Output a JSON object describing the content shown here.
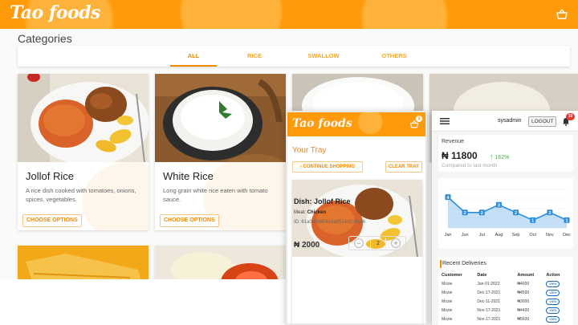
{
  "site": {
    "logo": "Tao foods",
    "categories_title": "Categories",
    "tabs": [
      {
        "label": "ALL",
        "active": true
      },
      {
        "label": "RICE",
        "active": false
      },
      {
        "label": "SWALLOW",
        "active": false
      },
      {
        "label": "OTHERS",
        "active": false
      }
    ],
    "cards": [
      {
        "title": "Jollof Rice",
        "description": "A rice dish cooked with tomatoes, onions, spices, vegetables.",
        "button": "CHOOSE OPTIONS"
      },
      {
        "title": "White Rice",
        "description": "Long grain white rice eaten with tomato sauce.",
        "button": "CHOOSE OPTIONS"
      }
    ]
  },
  "phone": {
    "logo": "Tao foods",
    "cart_count": "1",
    "tray_title": "Your Tray",
    "continue_label": "CONTINUE SHOPPING",
    "clear_label": "CLEAR TRAY",
    "dish_label": "Dish: Jollof Rice",
    "meat_label": "Meat:",
    "meat_value": "Chicken",
    "order_id": "ID: 61a0b5b804e3a9514c010e66",
    "price": "₦ 2000",
    "quantity": "2"
  },
  "admin": {
    "username": "sysadmin",
    "logout_label": "LOGOUT",
    "notification_count": "10",
    "revenue_label": "Revenue",
    "revenue_amount": "₦ 11800",
    "revenue_change": "162%",
    "compared_text": "Compared to last month",
    "deliveries_title": "Recent Deliveries",
    "columns": [
      "Customer",
      "Date",
      "Amount",
      "Action"
    ],
    "rows": [
      {
        "customer": "Mozie",
        "date": "Jan-01-2022",
        "amount": "₦4000",
        "action": "view"
      },
      {
        "customer": "Mozie",
        "date": "Dec-17-2021",
        "amount": "₦4500",
        "action": "view"
      },
      {
        "customer": "Mozie",
        "date": "Dec-11-2021",
        "amount": "₦3000",
        "action": "view"
      },
      {
        "customer": "Mozie",
        "date": "Nov-17-2021",
        "amount": "₦4400",
        "action": "view"
      },
      {
        "customer": "Mozie",
        "date": "Nov-17-2021",
        "amount": "₦5600",
        "action": "view"
      }
    ]
  },
  "chart_data": {
    "type": "area",
    "categories": [
      "Jan",
      "Jun",
      "Jul",
      "Aug",
      "Sep",
      "Oct",
      "Nov",
      "Dec"
    ],
    "values": [
      4,
      2,
      2,
      3,
      2,
      1,
      2,
      1
    ],
    "ylim": [
      0,
      5
    ],
    "grid": true,
    "color": "#2b8de0"
  },
  "colors": {
    "brand_orange": "#ff9a0a",
    "accent_orange": "#f08a00",
    "positive_green": "#4caf50",
    "alert_red": "#e53935"
  }
}
